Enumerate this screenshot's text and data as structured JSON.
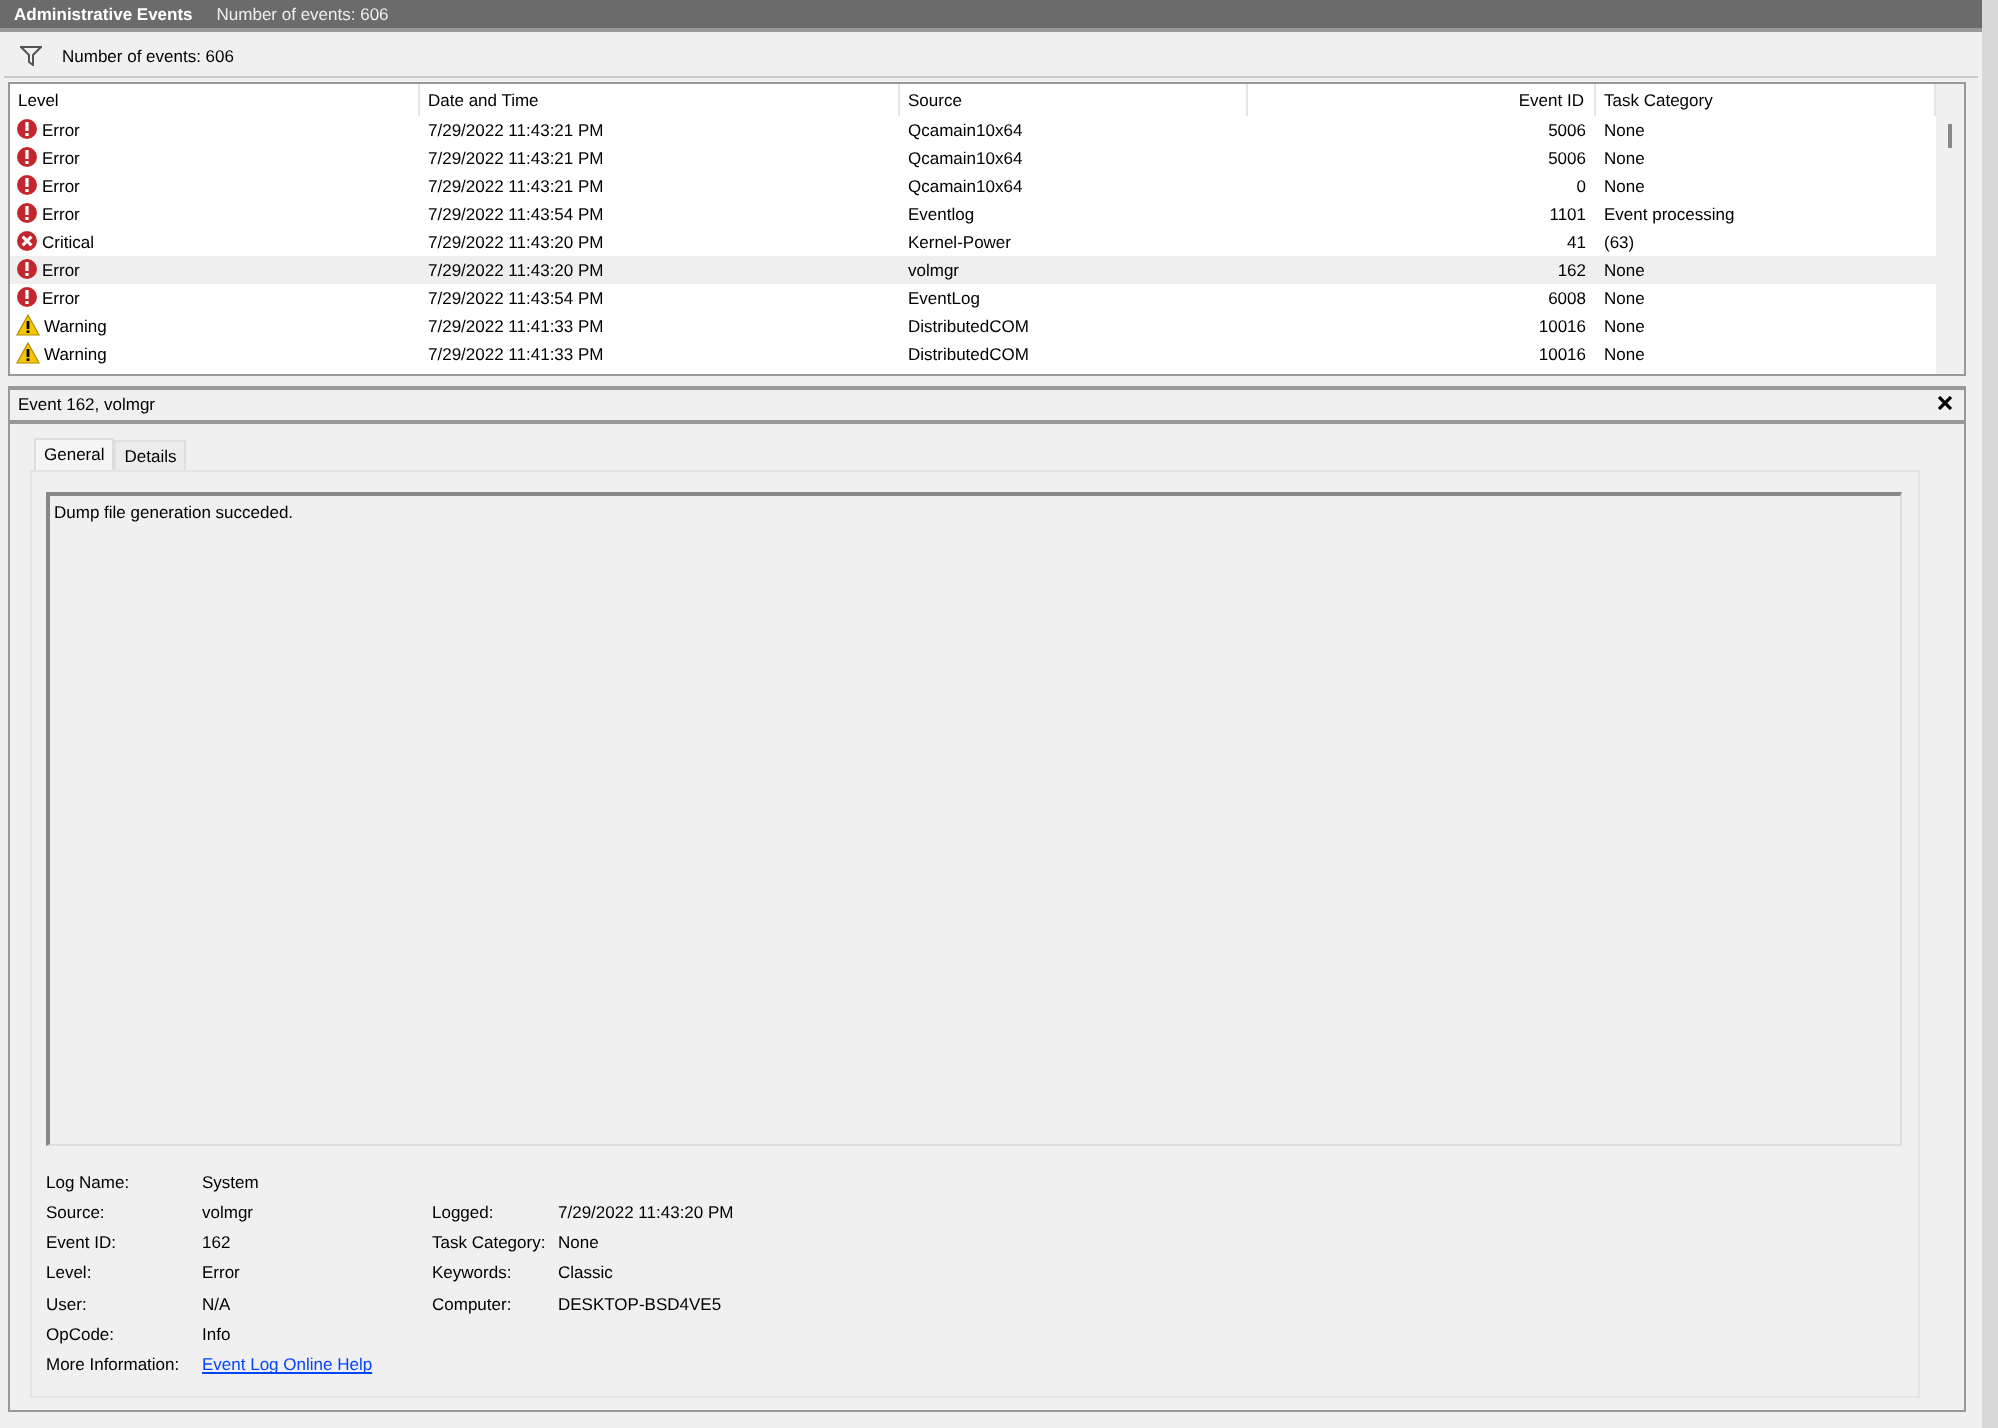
{
  "header": {
    "title": "Administrative Events",
    "count": "Number of events: 606"
  },
  "filter_bar": {
    "text": "Number of events: 606"
  },
  "table": {
    "columns": [
      "Level",
      "Date and Time",
      "Source",
      "Event ID",
      "Task Category"
    ],
    "rows": [
      {
        "level": "Error",
        "kind": "error",
        "date": "7/29/2022 11:43:21 PM",
        "source": "Qcamain10x64",
        "event_id": "5006",
        "task_category": "None",
        "selected": false
      },
      {
        "level": "Error",
        "kind": "error",
        "date": "7/29/2022 11:43:21 PM",
        "source": "Qcamain10x64",
        "event_id": "5006",
        "task_category": "None",
        "selected": false
      },
      {
        "level": "Error",
        "kind": "error",
        "date": "7/29/2022 11:43:21 PM",
        "source": "Qcamain10x64",
        "event_id": "0",
        "task_category": "None",
        "selected": false
      },
      {
        "level": "Error",
        "kind": "error",
        "date": "7/29/2022 11:43:54 PM",
        "source": "Eventlog",
        "event_id": "1101",
        "task_category": "Event processing",
        "selected": false
      },
      {
        "level": "Critical",
        "kind": "critical",
        "date": "7/29/2022 11:43:20 PM",
        "source": "Kernel-Power",
        "event_id": "41",
        "task_category": "(63)",
        "selected": false
      },
      {
        "level": "Error",
        "kind": "error",
        "date": "7/29/2022 11:43:20 PM",
        "source": "volmgr",
        "event_id": "162",
        "task_category": "None",
        "selected": true
      },
      {
        "level": "Error",
        "kind": "error",
        "date": "7/29/2022 11:43:54 PM",
        "source": "EventLog",
        "event_id": "6008",
        "task_category": "None",
        "selected": false
      },
      {
        "level": "Warning",
        "kind": "warning",
        "date": "7/29/2022 11:41:33 PM",
        "source": "DistributedCOM",
        "event_id": "10016",
        "task_category": "None",
        "selected": false
      },
      {
        "level": "Warning",
        "kind": "warning",
        "date": "7/29/2022 11:41:33 PM",
        "source": "DistributedCOM",
        "event_id": "10016",
        "task_category": "None",
        "selected": false
      }
    ]
  },
  "detail": {
    "title": "Event 162, volmgr",
    "tabs": [
      {
        "label": "General",
        "selected": true
      },
      {
        "label": "Details",
        "selected": false
      }
    ],
    "message": "Dump file generation succeded.",
    "properties_left": [
      {
        "label": "Log Name:",
        "value": "System"
      },
      {
        "label": "Source:",
        "value": "volmgr"
      },
      {
        "label": "Event ID:",
        "value": "162"
      },
      {
        "label": "Level:",
        "value": "Error"
      },
      {
        "label": "User:",
        "value": "N/A"
      },
      {
        "label": "OpCode:",
        "value": "Info"
      }
    ],
    "properties_right": [
      {
        "label": "Logged:",
        "value": "7/29/2022 11:43:20 PM"
      },
      {
        "label": "Task Category:",
        "value": "None"
      },
      {
        "label": "Keywords:",
        "value": "Classic"
      },
      {
        "label": "Computer:",
        "value": "DESKTOP-BSD4VE5"
      }
    ],
    "more_information": {
      "label": "More Information:",
      "link": "Event Log Online Help"
    }
  }
}
